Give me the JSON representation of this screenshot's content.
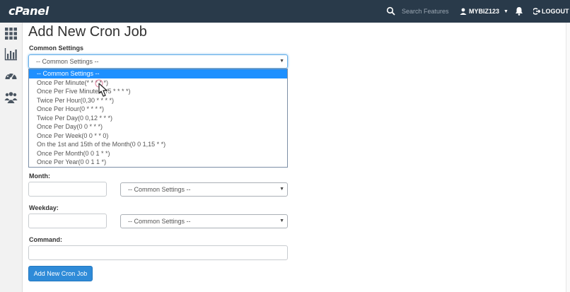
{
  "brand": "cPanel",
  "header": {
    "search_placeholder": "Search Features",
    "username": "MYBIZ123",
    "logout_label": "LOGOUT"
  },
  "page": {
    "title": "Add New Cron Job",
    "common_settings_label": "Common Settings",
    "common_settings_value": "-- Common Settings --",
    "month_label": "Month:",
    "month_select_value": "-- Common Settings --",
    "weekday_label": "Weekday:",
    "weekday_select_value": "-- Common Settings --",
    "command_label": "Command:",
    "submit_label": "Add New Cron Job"
  },
  "dropdown": {
    "options": [
      "-- Common Settings --",
      "Once Per Minute(* * * * *)",
      "Once Per Five Minutes(*/5 * * * *)",
      "Twice Per Hour(0,30 * * * *)",
      "Once Per Hour(0 * * * *)",
      "Twice Per Day(0 0,12 * * *)",
      "Once Per Day(0 0 * * *)",
      "Once Per Week(0 0 * * 0)",
      "On the 1st and 15th of the Month(0 0 1,15 * *)",
      "Once Per Month(0 0 1 * *)",
      "Once Per Year(0 0 1 1 *)"
    ],
    "selected_index": 0
  },
  "sidebar": {
    "items": [
      "grid-icon",
      "stats-icon",
      "dashboard-icon",
      "users-icon"
    ]
  },
  "colors": {
    "topbar": "#293a4a",
    "accent": "#2f8bd8",
    "selected_option": "#1e90ff"
  }
}
